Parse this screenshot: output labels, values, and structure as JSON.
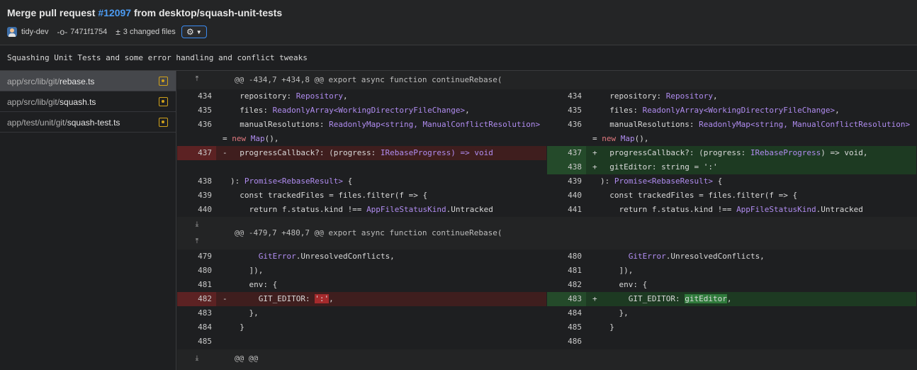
{
  "header": {
    "title_prefix": "Merge pull request ",
    "pr_number": "#12097",
    "title_suffix": " from desktop/squash-unit-tests",
    "author": "tidy-dev",
    "commit_sha": "7471f1754",
    "changed_files": "3 changed files"
  },
  "summary": "Squashing Unit Tests and some error handling and conflict tweaks",
  "files": [
    {
      "dir": "app/src/lib/git/",
      "name": "rebase.ts",
      "status": "modified",
      "selected": true
    },
    {
      "dir": "app/src/lib/git/",
      "name": "squash.ts",
      "status": "modified",
      "selected": false
    },
    {
      "dir": "app/test/unit/git/",
      "name": "squash-test.ts",
      "status": "modified",
      "selected": false
    }
  ],
  "diff": {
    "hunk1_header": "@@ -434,7 +434,8 @@ export async function continueRebase(",
    "hunk2_header": "@@ -479,7 +480,7 @@ export async function continueRebase(",
    "hunk3_header": "@@ @@",
    "left": [
      {
        "num": "434",
        "prefix": "",
        "a": "  repository: ",
        "t": "Repository",
        "b": ","
      },
      {
        "num": "435",
        "prefix": "",
        "a": "  files: ",
        "t": "ReadonlyArray<WorkingDirectoryFileChange>",
        "b": ","
      },
      {
        "num": "436",
        "prefix": "",
        "a": "  manualResolutions: ",
        "t": "ReadonlyMap<string, ManualConflictResolution>",
        "b": ""
      },
      {
        "cont_a": "= ",
        "cont_k": "new ",
        "cont_t": "Map",
        "cont_b": "(),"
      },
      {
        "num": "437",
        "prefix": "-",
        "a": "  progressCallback?: (progress: ",
        "t": "IRebaseProgress",
        "b": ") => void"
      },
      {
        "num": "438",
        "prefix": "",
        "a": "): ",
        "t": "Promise<RebaseResult>",
        "b": " {"
      },
      {
        "num": "439",
        "prefix": "",
        "a": "  const trackedFiles = files.filter(f => {",
        "t": "",
        "b": ""
      },
      {
        "num": "440",
        "prefix": "",
        "a": "    return f.status.kind !== ",
        "t": "AppFileStatusKind",
        "b": ".Untracked"
      },
      {
        "num": "479",
        "prefix": "",
        "a": "      ",
        "t": "GitError",
        "b": ".UnresolvedConflicts,"
      },
      {
        "num": "480",
        "prefix": "",
        "a": "    ]),",
        "t": "",
        "b": ""
      },
      {
        "num": "481",
        "prefix": "",
        "a": "    env: {",
        "t": "",
        "b": ""
      },
      {
        "num": "482",
        "prefix": "-",
        "a": "      GIT_EDITOR: ",
        "hl": "':'",
        "b": ","
      },
      {
        "num": "483",
        "prefix": "",
        "a": "    },",
        "t": "",
        "b": ""
      },
      {
        "num": "484",
        "prefix": "",
        "a": "  }",
        "t": "",
        "b": ""
      },
      {
        "num": "485",
        "prefix": "",
        "a": "",
        "t": "",
        "b": ""
      }
    ],
    "right": [
      {
        "num": "434",
        "prefix": "",
        "a": "  repository: ",
        "t": "Repository",
        "b": ","
      },
      {
        "num": "435",
        "prefix": "",
        "a": "  files: ",
        "t": "ReadonlyArray<WorkingDirectoryFileChange>",
        "b": ","
      },
      {
        "num": "436",
        "prefix": "",
        "a": "  manualResolutions: ",
        "t": "ReadonlyMap<string, ManualConflictResolution>",
        "b": ""
      },
      {
        "cont_a": "= ",
        "cont_k": "new ",
        "cont_t": "Map",
        "cont_b": "(),"
      },
      {
        "num": "437",
        "prefix": "+",
        "a": "  progressCallback?: (progress: ",
        "t": "IRebaseProgress",
        "b": ") => void,"
      },
      {
        "num": "438",
        "prefix": "+",
        "a": "  gitEditor: string = ':'",
        "t": "",
        "b": ""
      },
      {
        "num": "439",
        "prefix": "",
        "a": "): ",
        "t": "Promise<RebaseResult>",
        "b": " {"
      },
      {
        "num": "440",
        "prefix": "",
        "a": "  const trackedFiles = files.filter(f => {",
        "t": "",
        "b": ""
      },
      {
        "num": "441",
        "prefix": "",
        "a": "    return f.status.kind !== ",
        "t": "AppFileStatusKind",
        "b": ".Untracked"
      },
      {
        "num": "480",
        "prefix": "",
        "a": "      ",
        "t": "GitError",
        "b": ".UnresolvedConflicts,"
      },
      {
        "num": "481",
        "prefix": "",
        "a": "    ]),",
        "t": "",
        "b": ""
      },
      {
        "num": "482",
        "prefix": "",
        "a": "    env: {",
        "t": "",
        "b": ""
      },
      {
        "num": "483",
        "prefix": "+",
        "a": "      GIT_EDITOR: ",
        "hl": "gitEditor",
        "b": ","
      },
      {
        "num": "484",
        "prefix": "",
        "a": "    },",
        "t": "",
        "b": ""
      },
      {
        "num": "485",
        "prefix": "",
        "a": "  }",
        "t": "",
        "b": ""
      },
      {
        "num": "486",
        "prefix": "",
        "a": "",
        "t": "",
        "b": ""
      }
    ]
  },
  "colors": {
    "accent": "#4c9bf2",
    "deleted_bg": "#3f1e1e",
    "added_bg": "#1d3a22",
    "modified_badge": "#d0a21b"
  }
}
